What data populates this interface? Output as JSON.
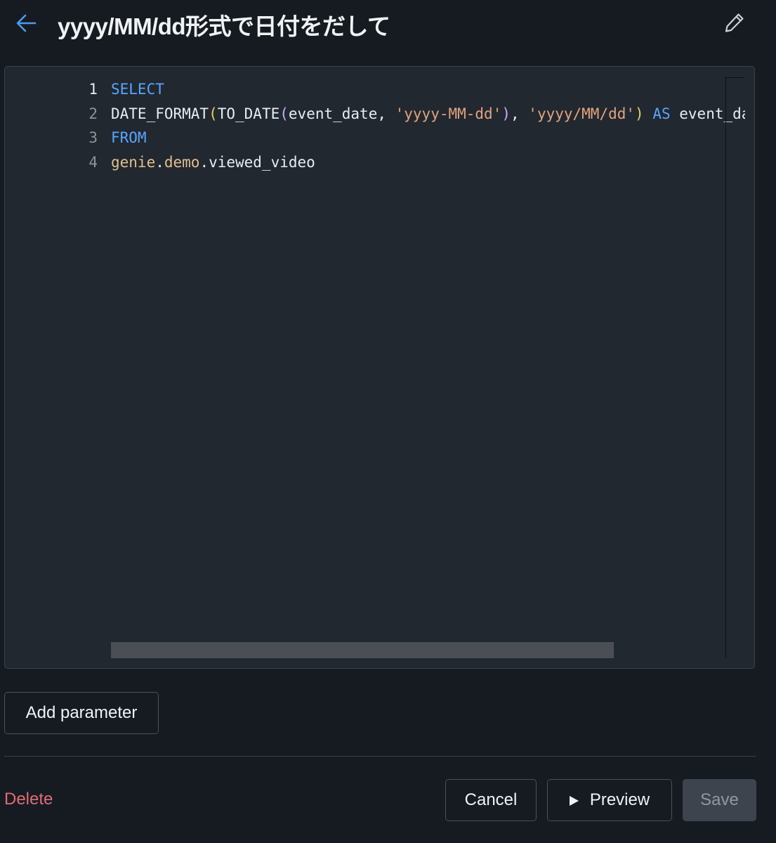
{
  "header": {
    "title": "yyyy/MM/dd形式で日付をだして",
    "back_icon": "arrow-left-icon",
    "edit_icon": "pencil-icon"
  },
  "editor": {
    "lines": [
      {
        "number": "1",
        "segments": [
          {
            "text": "SELECT",
            "type": "kw"
          }
        ]
      },
      {
        "number": "2",
        "segments": [
          {
            "text": "DATE_FORMAT",
            "type": "fn"
          },
          {
            "text": "(",
            "type": "p1"
          },
          {
            "text": "TO_DATE",
            "type": "fn"
          },
          {
            "text": "(",
            "type": "p2"
          },
          {
            "text": "event_date, ",
            "type": "fn"
          },
          {
            "text": "'yyyy-MM-dd'",
            "type": "str"
          },
          {
            "text": ")",
            "type": "p2"
          },
          {
            "text": ", ",
            "type": "fn"
          },
          {
            "text": "'yyyy/MM/dd'",
            "type": "str"
          },
          {
            "text": ")",
            "type": "p1"
          },
          {
            "text": " ",
            "type": "fn"
          },
          {
            "text": "AS",
            "type": "kw"
          },
          {
            "text": " event_date",
            "type": "fn"
          }
        ]
      },
      {
        "number": "3",
        "segments": [
          {
            "text": "FROM",
            "type": "kw"
          }
        ]
      },
      {
        "number": "4",
        "segments": [
          {
            "text": "genie",
            "type": "ident"
          },
          {
            "text": ".",
            "type": "fn"
          },
          {
            "text": "demo",
            "type": "ident"
          },
          {
            "text": ".viewed_video",
            "type": "fn"
          }
        ]
      }
    ]
  },
  "actions": {
    "add_parameter": "Add parameter",
    "delete": "Delete",
    "cancel": "Cancel",
    "preview": "Preview",
    "save": "Save"
  },
  "colors": {
    "background": "#161b22",
    "editor_bg": "#212830",
    "keyword": "#58a6ff",
    "string": "#e3a37c",
    "delete": "#e06c75"
  }
}
